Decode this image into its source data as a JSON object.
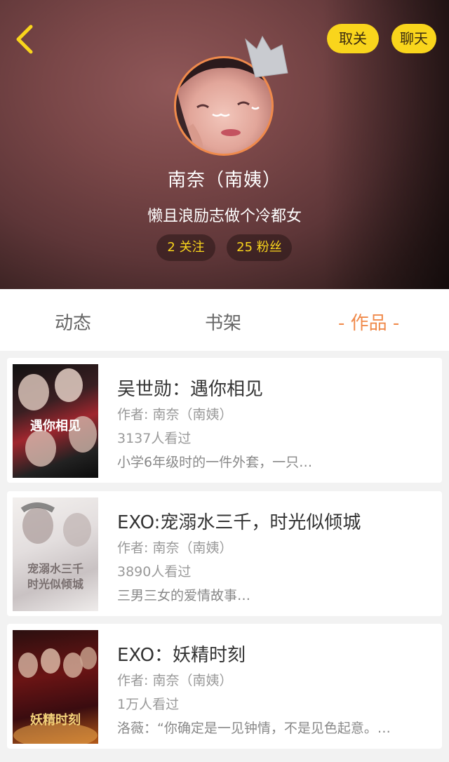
{
  "header": {
    "unfollow_label": "取关",
    "chat_label": "聊天",
    "name": "南奈（南姨）",
    "bio": "懒且浪励志做个冷都女",
    "following": "2 关注",
    "fans": "25 粉丝"
  },
  "tabs": [
    {
      "label": "动态"
    },
    {
      "label": "书架"
    },
    {
      "label": "- 作品 -"
    }
  ],
  "works": [
    {
      "title": "吴世勋：遇你相见",
      "author": "作者: 南奈（南姨）",
      "views": "3137人看过",
      "desc": "小学6年级时的一件外套，一只…",
      "cover_text": "遇你相见"
    },
    {
      "title": "EXO:宠溺水三千，时光似倾城",
      "author": "作者: 南奈（南姨）",
      "views": "3890人看过",
      "desc": "三男三女的爱情故事…",
      "cover_text": "宠溺水三千",
      "cover_text2": "时光似倾城"
    },
    {
      "title": "EXO：妖精时刻",
      "author": "作者: 南奈（南姨）",
      "views": "1万人看过",
      "desc": "洛薇：“你确定是一见钟情，不是见色起意。…",
      "cover_text": "妖精时刻"
    }
  ],
  "icons": {
    "back": "chevron-left-icon",
    "crown": "crown-icon"
  },
  "colors": {
    "accent_yellow": "#f9d51c",
    "accent_orange": "#f08a4b"
  }
}
